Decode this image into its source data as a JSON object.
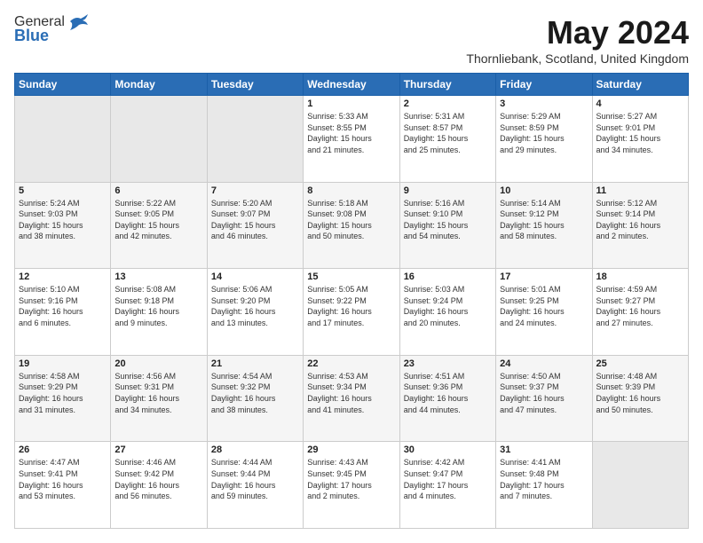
{
  "header": {
    "logo_general": "General",
    "logo_blue": "Blue",
    "month": "May 2024",
    "location": "Thornliebank, Scotland, United Kingdom"
  },
  "days_of_week": [
    "Sunday",
    "Monday",
    "Tuesday",
    "Wednesday",
    "Thursday",
    "Friday",
    "Saturday"
  ],
  "weeks": [
    [
      {
        "day": "",
        "detail": ""
      },
      {
        "day": "",
        "detail": ""
      },
      {
        "day": "",
        "detail": ""
      },
      {
        "day": "1",
        "detail": "Sunrise: 5:33 AM\nSunset: 8:55 PM\nDaylight: 15 hours\nand 21 minutes."
      },
      {
        "day": "2",
        "detail": "Sunrise: 5:31 AM\nSunset: 8:57 PM\nDaylight: 15 hours\nand 25 minutes."
      },
      {
        "day": "3",
        "detail": "Sunrise: 5:29 AM\nSunset: 8:59 PM\nDaylight: 15 hours\nand 29 minutes."
      },
      {
        "day": "4",
        "detail": "Sunrise: 5:27 AM\nSunset: 9:01 PM\nDaylight: 15 hours\nand 34 minutes."
      }
    ],
    [
      {
        "day": "5",
        "detail": "Sunrise: 5:24 AM\nSunset: 9:03 PM\nDaylight: 15 hours\nand 38 minutes."
      },
      {
        "day": "6",
        "detail": "Sunrise: 5:22 AM\nSunset: 9:05 PM\nDaylight: 15 hours\nand 42 minutes."
      },
      {
        "day": "7",
        "detail": "Sunrise: 5:20 AM\nSunset: 9:07 PM\nDaylight: 15 hours\nand 46 minutes."
      },
      {
        "day": "8",
        "detail": "Sunrise: 5:18 AM\nSunset: 9:08 PM\nDaylight: 15 hours\nand 50 minutes."
      },
      {
        "day": "9",
        "detail": "Sunrise: 5:16 AM\nSunset: 9:10 PM\nDaylight: 15 hours\nand 54 minutes."
      },
      {
        "day": "10",
        "detail": "Sunrise: 5:14 AM\nSunset: 9:12 PM\nDaylight: 15 hours\nand 58 minutes."
      },
      {
        "day": "11",
        "detail": "Sunrise: 5:12 AM\nSunset: 9:14 PM\nDaylight: 16 hours\nand 2 minutes."
      }
    ],
    [
      {
        "day": "12",
        "detail": "Sunrise: 5:10 AM\nSunset: 9:16 PM\nDaylight: 16 hours\nand 6 minutes."
      },
      {
        "day": "13",
        "detail": "Sunrise: 5:08 AM\nSunset: 9:18 PM\nDaylight: 16 hours\nand 9 minutes."
      },
      {
        "day": "14",
        "detail": "Sunrise: 5:06 AM\nSunset: 9:20 PM\nDaylight: 16 hours\nand 13 minutes."
      },
      {
        "day": "15",
        "detail": "Sunrise: 5:05 AM\nSunset: 9:22 PM\nDaylight: 16 hours\nand 17 minutes."
      },
      {
        "day": "16",
        "detail": "Sunrise: 5:03 AM\nSunset: 9:24 PM\nDaylight: 16 hours\nand 20 minutes."
      },
      {
        "day": "17",
        "detail": "Sunrise: 5:01 AM\nSunset: 9:25 PM\nDaylight: 16 hours\nand 24 minutes."
      },
      {
        "day": "18",
        "detail": "Sunrise: 4:59 AM\nSunset: 9:27 PM\nDaylight: 16 hours\nand 27 minutes."
      }
    ],
    [
      {
        "day": "19",
        "detail": "Sunrise: 4:58 AM\nSunset: 9:29 PM\nDaylight: 16 hours\nand 31 minutes."
      },
      {
        "day": "20",
        "detail": "Sunrise: 4:56 AM\nSunset: 9:31 PM\nDaylight: 16 hours\nand 34 minutes."
      },
      {
        "day": "21",
        "detail": "Sunrise: 4:54 AM\nSunset: 9:32 PM\nDaylight: 16 hours\nand 38 minutes."
      },
      {
        "day": "22",
        "detail": "Sunrise: 4:53 AM\nSunset: 9:34 PM\nDaylight: 16 hours\nand 41 minutes."
      },
      {
        "day": "23",
        "detail": "Sunrise: 4:51 AM\nSunset: 9:36 PM\nDaylight: 16 hours\nand 44 minutes."
      },
      {
        "day": "24",
        "detail": "Sunrise: 4:50 AM\nSunset: 9:37 PM\nDaylight: 16 hours\nand 47 minutes."
      },
      {
        "day": "25",
        "detail": "Sunrise: 4:48 AM\nSunset: 9:39 PM\nDaylight: 16 hours\nand 50 minutes."
      }
    ],
    [
      {
        "day": "26",
        "detail": "Sunrise: 4:47 AM\nSunset: 9:41 PM\nDaylight: 16 hours\nand 53 minutes."
      },
      {
        "day": "27",
        "detail": "Sunrise: 4:46 AM\nSunset: 9:42 PM\nDaylight: 16 hours\nand 56 minutes."
      },
      {
        "day": "28",
        "detail": "Sunrise: 4:44 AM\nSunset: 9:44 PM\nDaylight: 16 hours\nand 59 minutes."
      },
      {
        "day": "29",
        "detail": "Sunrise: 4:43 AM\nSunset: 9:45 PM\nDaylight: 17 hours\nand 2 minutes."
      },
      {
        "day": "30",
        "detail": "Sunrise: 4:42 AM\nSunset: 9:47 PM\nDaylight: 17 hours\nand 4 minutes."
      },
      {
        "day": "31",
        "detail": "Sunrise: 4:41 AM\nSunset: 9:48 PM\nDaylight: 17 hours\nand 7 minutes."
      },
      {
        "day": "",
        "detail": ""
      }
    ]
  ]
}
